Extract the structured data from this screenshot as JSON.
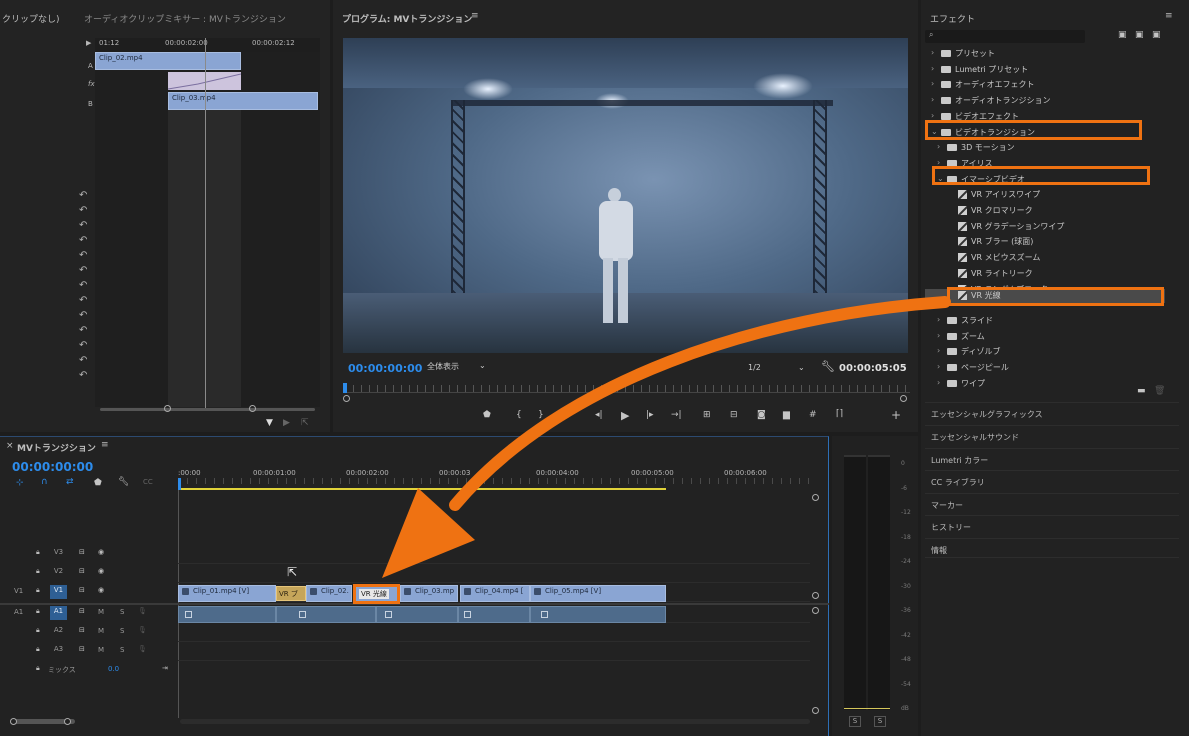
{
  "source_panel": {
    "tab_partial": "クリップなし)",
    "title": "オーディオクリップミキサー : MVトランジション",
    "ruler": [
      "01:12",
      "00:00:02:00",
      "00:00:02:12"
    ],
    "track_a": "A",
    "track_fx": "fx",
    "track_b": "B",
    "clip_a": "Clip_02.mp4",
    "clip_b": "Clip_03.mp4"
  },
  "program_monitor": {
    "title": "プログラム: MVトランジション",
    "timecode_start": "00:00:00:00",
    "fit": "全体表示",
    "resolution": "1/2",
    "timecode_end": "00:00:05:05"
  },
  "effects_panel": {
    "title": "エフェクト",
    "search_placeholder": "",
    "items": [
      {
        "label": "プリセット",
        "level": 0,
        "expanded": false,
        "type": "star-folder"
      },
      {
        "label": "Lumetri プリセット",
        "level": 0,
        "expanded": false,
        "type": "star-folder"
      },
      {
        "label": "オーディオエフェクト",
        "level": 0,
        "expanded": false,
        "type": "folder"
      },
      {
        "label": "オーディオトランジション",
        "level": 0,
        "expanded": false,
        "type": "folder"
      },
      {
        "label": "ビデオエフェクト",
        "level": 0,
        "expanded": false,
        "type": "folder"
      },
      {
        "label": "ビデオトランジション",
        "level": 0,
        "expanded": true,
        "type": "folder"
      },
      {
        "label": "3D モーション",
        "level": 1,
        "expanded": false,
        "type": "folder"
      },
      {
        "label": "アイリス",
        "level": 1,
        "expanded": false,
        "type": "folder"
      },
      {
        "label": "イマーシブビデオ",
        "level": 1,
        "expanded": true,
        "type": "folder"
      },
      {
        "label": "VR アイリスワイプ",
        "level": 2,
        "type": "effect"
      },
      {
        "label": "VR クロマリーク",
        "level": 2,
        "type": "effect"
      },
      {
        "label": "VR グラデーションワイプ",
        "level": 2,
        "type": "effect"
      },
      {
        "label": "VR ブラー (球面)",
        "level": 2,
        "type": "effect"
      },
      {
        "label": "VR メビウスズーム",
        "level": 2,
        "type": "effect"
      },
      {
        "label": "VR ライトリーク",
        "level": 2,
        "type": "effect"
      },
      {
        "label": "VR ランダムブロック",
        "level": 2,
        "type": "effect"
      },
      {
        "label": "VR 光線",
        "level": 2,
        "type": "effect",
        "selected": true
      },
      {
        "label": "スライド",
        "level": 1,
        "expanded": false,
        "type": "folder"
      },
      {
        "label": "ズーム",
        "level": 1,
        "expanded": false,
        "type": "folder"
      },
      {
        "label": "ディゾルブ",
        "level": 1,
        "expanded": false,
        "type": "folder"
      },
      {
        "label": "ページピール",
        "level": 1,
        "expanded": false,
        "type": "folder"
      },
      {
        "label": "ワイプ",
        "level": 1,
        "expanded": false,
        "type": "folder"
      }
    ],
    "sections": [
      "エッセンシャルグラフィックス",
      "エッセンシャルサウンド",
      "Lumetri カラー",
      "CC ライブラリ",
      "マーカー",
      "ヒストリー",
      "情報"
    ]
  },
  "timeline": {
    "title": "MVトランジション",
    "timecode": "00:00:00:00",
    "ruler": [
      ":00:00",
      "00:00:01:00",
      "00:00:02:00",
      "00:00:03",
      "00:00:04:00",
      "00:00:05:00",
      "00:00:06:00"
    ],
    "tracks": [
      {
        "name": "V3"
      },
      {
        "name": "V2"
      },
      {
        "name": "V1",
        "src": "V1"
      },
      {
        "name": "A1",
        "src": "A1",
        "m": "M",
        "s": "S"
      },
      {
        "name": "A2",
        "m": "M",
        "s": "S"
      },
      {
        "name": "A3",
        "m": "M",
        "s": "S"
      }
    ],
    "mix_label": "ミックス",
    "mix_value": "0.0",
    "clips": [
      "Clip_01.mp4 [V]",
      "Clip_02.",
      "Clip_03.mp",
      "Clip_04.mp4 [",
      "Clip_05.mp4 [V]"
    ],
    "transition_1": "VR ブ",
    "transition_2": "VR 光線"
  },
  "audio_meter": {
    "scale": [
      "0",
      "-6",
      "-12",
      "-18",
      "-24",
      "-30",
      "-36",
      "-42",
      "-48",
      "-54",
      "dB"
    ],
    "solo_1": "S",
    "solo_2": "S"
  },
  "colors": {
    "accent": "#2d8ceb",
    "annotation": "#ef7212",
    "clip": "#8aa5d3"
  }
}
